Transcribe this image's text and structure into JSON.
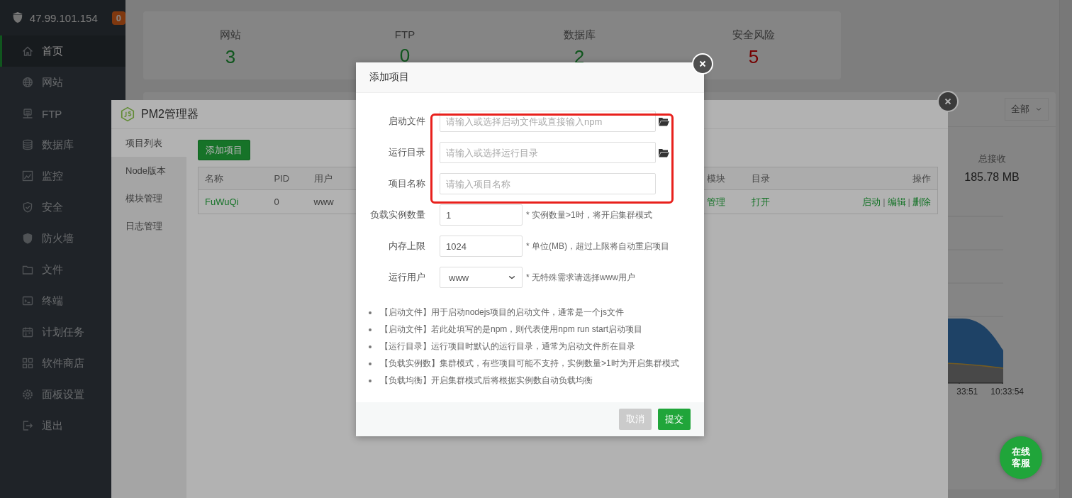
{
  "sidebar": {
    "server": "47.99.101.154",
    "badge": "0",
    "items": [
      {
        "label": "首页",
        "selected": true
      },
      {
        "label": "网站",
        "selected": false
      },
      {
        "label": "FTP",
        "selected": false
      },
      {
        "label": "数据库",
        "selected": false
      },
      {
        "label": "监控",
        "selected": false
      },
      {
        "label": "安全",
        "selected": false
      },
      {
        "label": "防火墙",
        "selected": false
      },
      {
        "label": "文件",
        "selected": false
      },
      {
        "label": "终端",
        "selected": false
      },
      {
        "label": "计划任务",
        "selected": false
      },
      {
        "label": "软件商店",
        "selected": false
      },
      {
        "label": "面板设置",
        "selected": false
      },
      {
        "label": "退出",
        "selected": false
      }
    ]
  },
  "stats": [
    {
      "label": "网站",
      "value": "3",
      "kind": "normal"
    },
    {
      "label": "FTP",
      "value": "0",
      "kind": "normal"
    },
    {
      "label": "数据库",
      "value": "2",
      "kind": "normal"
    },
    {
      "label": "安全风险",
      "value": "5",
      "kind": "alert"
    }
  ],
  "traffic": {
    "filter": "全部",
    "total_label": "总接收",
    "total_value": "185.78 MB",
    "time_labels": [
      "33:51",
      "10:33:54"
    ]
  },
  "pm2_window": {
    "title": "PM2管理器",
    "tabs": [
      {
        "label": "项目列表",
        "selected": true
      },
      {
        "label": "Node版本",
        "selected": false
      },
      {
        "label": "模块管理",
        "selected": false
      },
      {
        "label": "日志管理",
        "selected": false
      }
    ],
    "add_button": "添加项目",
    "table": {
      "columns": [
        "名称",
        "PID",
        "用户",
        "模块",
        "目录",
        "操作"
      ],
      "rows": [
        {
          "cells": [
            {
              "kind": "link",
              "text": "FuWuQi"
            },
            {
              "kind": "text",
              "text": "0"
            },
            {
              "kind": "text",
              "text": "www"
            },
            {
              "kind": "link",
              "text": "管理"
            },
            {
              "kind": "link",
              "text": "打开"
            }
          ],
          "actions": [
            {
              "kind": "link",
              "text": "启动"
            },
            {
              "kind": "sep",
              "text": "|"
            },
            {
              "kind": "link",
              "text": "编辑"
            },
            {
              "kind": "sep",
              "text": "|"
            },
            {
              "kind": "link",
              "text": "删除"
            }
          ]
        }
      ]
    }
  },
  "dialog": {
    "title": "添加项目",
    "fields": [
      {
        "kind": "path",
        "label": "启动文件",
        "placeholder": "请输入或选择启动文件或直接输入npm"
      },
      {
        "kind": "path",
        "label": "运行目录",
        "placeholder": "请输入或选择运行目录"
      },
      {
        "kind": "text",
        "label": "项目名称",
        "placeholder": "请输入项目名称"
      },
      {
        "kind": "number",
        "label": "负载实例数量",
        "value": "1",
        "hint": "* 实例数量>1时，将开启集群模式"
      },
      {
        "kind": "number",
        "label": "内存上限",
        "value": "1024",
        "hint": "* 单位(MB)，超过上限将自动重启项目"
      },
      {
        "kind": "select",
        "label": "运行用户",
        "value": "www",
        "hint": "* 无特殊需求请选择www用户"
      }
    ],
    "notes": [
      "【启动文件】用于启动nodejs项目的启动文件，通常是一个js文件",
      "【启动文件】若此处填写的是npm，则代表使用npm run start启动项目",
      "【运行目录】运行项目时默认的运行目录，通常为启动文件所在目录",
      "【负载实例数】集群模式，有些项目可能不支持，实例数量>1时为开启集群模式",
      "【负载均衡】开启集群模式后将根据实例数自动负载均衡"
    ],
    "buttons": [
      {
        "kind": "secondary",
        "label": "取消"
      },
      {
        "kind": "primary",
        "label": "提交"
      }
    ]
  },
  "chat_button": "在线客服"
}
